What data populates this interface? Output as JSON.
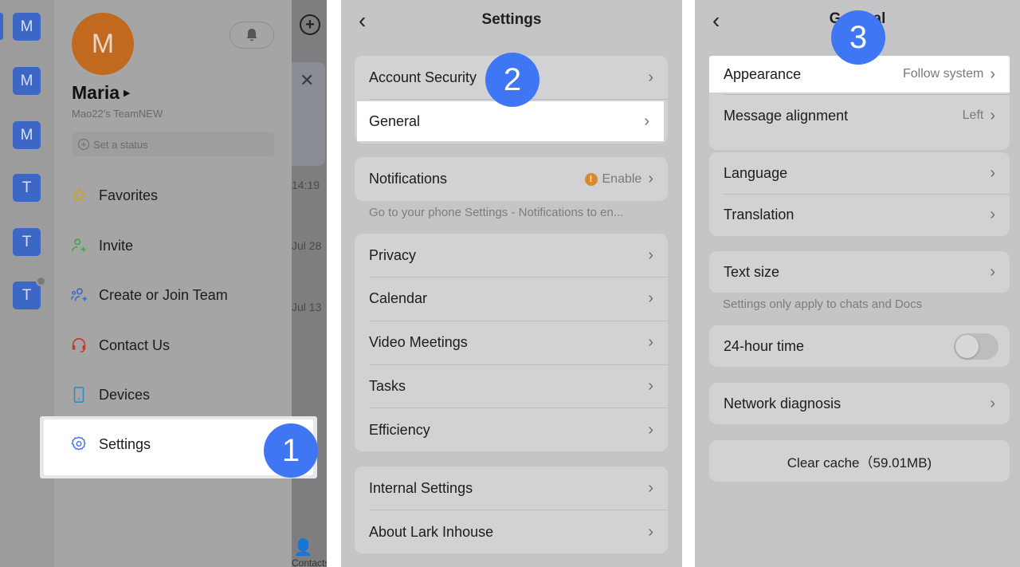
{
  "panel1": {
    "workspaces": [
      "M",
      "M",
      "M",
      "T",
      "T",
      "T"
    ],
    "avatar_letter": "M",
    "user_name": "Maria",
    "team_name": "Mao22's TeamNEW",
    "status_placeholder": "Set a status",
    "menu": [
      {
        "label": "Favorites",
        "icon": "star-icon",
        "color": "#c9a227"
      },
      {
        "label": "Invite",
        "icon": "invite-user-icon",
        "color": "#3aa64a"
      },
      {
        "label": "Create or Join Team",
        "icon": "team-icon",
        "color": "#3d67c4"
      },
      {
        "label": "Contact Us",
        "icon": "headset-icon",
        "color": "#c43a32"
      },
      {
        "label": "Devices",
        "icon": "phone-icon",
        "color": "#2e8fbf"
      },
      {
        "label": "Settings",
        "icon": "gear-icon",
        "color": "#3f76f3"
      }
    ],
    "background_times": [
      "14:19",
      "Jul 28",
      "Jul 13"
    ],
    "background_tab": "Contacts",
    "step_badge": "1"
  },
  "panel2": {
    "title": "Settings",
    "groups": [
      [
        {
          "label": "Account Security"
        },
        {
          "label": "General"
        }
      ],
      [
        {
          "label": "Notifications",
          "value": "Enable",
          "warning": true
        }
      ],
      [
        {
          "label": "Privacy"
        },
        {
          "label": "Calendar"
        },
        {
          "label": "Video Meetings"
        },
        {
          "label": "Tasks"
        },
        {
          "label": "Efficiency"
        }
      ],
      [
        {
          "label": "Internal Settings"
        },
        {
          "label": "About Lark Inhouse"
        }
      ]
    ],
    "notifications_note": "Go to your phone Settings - Notifications to en...",
    "step_badge": "2"
  },
  "panel3": {
    "title": "General",
    "groups": [
      [
        {
          "label": "Appearance",
          "value": "Follow system"
        },
        {
          "label": "Message alignment",
          "value": "Left"
        }
      ],
      [
        {
          "label": "Language"
        },
        {
          "label": "Translation"
        }
      ],
      [
        {
          "label": "Text size"
        }
      ],
      [
        {
          "label": "24-hour time",
          "toggle": false
        }
      ],
      [
        {
          "label": "Network diagnosis"
        }
      ]
    ],
    "text_size_note": "Settings only apply to chats and Docs",
    "clear_cache": "Clear cache（59.01MB)",
    "step_badge": "3"
  },
  "colors": {
    "accent": "#3f76f3",
    "workspace": "#3d67c4",
    "avatar": "#c0691f",
    "warning": "#d9892b"
  }
}
